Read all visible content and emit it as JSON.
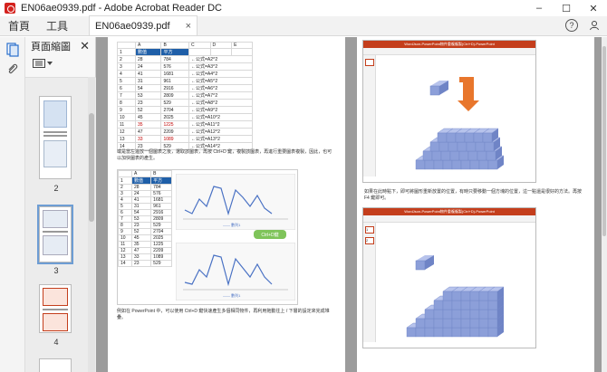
{
  "window": {
    "title": "EN06ae0939.pdf - Adobe Acrobat Reader DC",
    "minimize": "–",
    "maximize": "☐",
    "close": "✕"
  },
  "tabs": {
    "home": "首頁",
    "tools": "工具",
    "document": "EN06ae0939.pdf",
    "document_close": "×",
    "help": "?"
  },
  "panel": {
    "title": "頁面縮圖",
    "close": "✕",
    "thumbnails": [
      {
        "label": "2"
      },
      {
        "label": "3"
      },
      {
        "label": "4"
      }
    ]
  },
  "left_page": {
    "table1": {
      "cols": [
        "",
        "A",
        "B",
        "C",
        "D",
        "E"
      ],
      "header": [
        "1",
        "數值",
        "平方"
      ],
      "rows": [
        [
          "2",
          "28",
          "784",
          "←公式=A2^2"
        ],
        [
          "3",
          "24",
          "576",
          "←公式=A3^2"
        ],
        [
          "4",
          "41",
          "1681",
          "←公式=A4^2"
        ],
        [
          "5",
          "31",
          "961",
          "←公式=A5^2"
        ],
        [
          "6",
          "54",
          "2916",
          "←公式=A6^2"
        ],
        [
          "7",
          "53",
          "2809",
          "←公式=A7^2"
        ],
        [
          "8",
          "23",
          "529",
          "←公式=A8^2"
        ],
        [
          "9",
          "52",
          "2704",
          "←公式=A9^2"
        ],
        [
          "10",
          "45",
          "2025",
          "←公式=A10^2"
        ],
        [
          "11",
          "35",
          "1225",
          "←公式=A11^2"
        ],
        [
          "12",
          "47",
          "2209",
          "←公式=A12^2"
        ],
        [
          "13",
          "33",
          "1089",
          "←公式=A13^2"
        ],
        [
          "14",
          "23",
          "529",
          "←公式=A14^2"
        ]
      ]
    },
    "caption1": "或是當左邊放一個圖表之後，選取該圖表，再按 Ctrl+D 鍵，複製該圖表，再進行重要圖表複製，因此，也可以加快圖表的產生。",
    "table2": {
      "cols": [
        "",
        "A",
        "B"
      ],
      "header": [
        "1",
        "數值",
        "平方"
      ],
      "rows": [
        [
          "2",
          "28",
          "784"
        ],
        [
          "3",
          "24",
          "576"
        ],
        [
          "4",
          "41",
          "1681"
        ],
        [
          "5",
          "31",
          "961"
        ],
        [
          "6",
          "54",
          "2916"
        ],
        [
          "7",
          "53",
          "2809"
        ],
        [
          "8",
          "23",
          "529"
        ],
        [
          "9",
          "52",
          "2704"
        ],
        [
          "10",
          "45",
          "2025"
        ],
        [
          "11",
          "35",
          "1225"
        ],
        [
          "12",
          "47",
          "2209"
        ],
        [
          "13",
          "33",
          "1089"
        ],
        [
          "14",
          "23",
          "529"
        ]
      ]
    },
    "chart_badge": "Ctrl+D鍵",
    "legend": "—— 數列1",
    "caption2": "例如在 PowerPoint 中，可以使用 Ctrl+D 鍵快速產生多個相同物件，再利用拖動往上 / 下層的設定來完成堆疊。"
  },
  "right_page": {
    "ppt_title": "WordJson-PowerPoint物件重複複製(Ctrl+D)-PowerPoint",
    "caption": "如果在此時點下，即可將圖形重新放置的位置，有時只要移動一個方塊的位置，這一點還是很好的方法。再按 F4 鍵即可。",
    "slide_labels": [
      "1",
      "2"
    ]
  },
  "colors": {
    "accent": "#1f5fa8",
    "ppt": "#c43e1c",
    "arrow": "#e8762c",
    "cube_top": "#b7c3ec",
    "cube_front": "#8c9fd9",
    "cube_side": "#6f84c6",
    "badge": "#7fc45a"
  }
}
